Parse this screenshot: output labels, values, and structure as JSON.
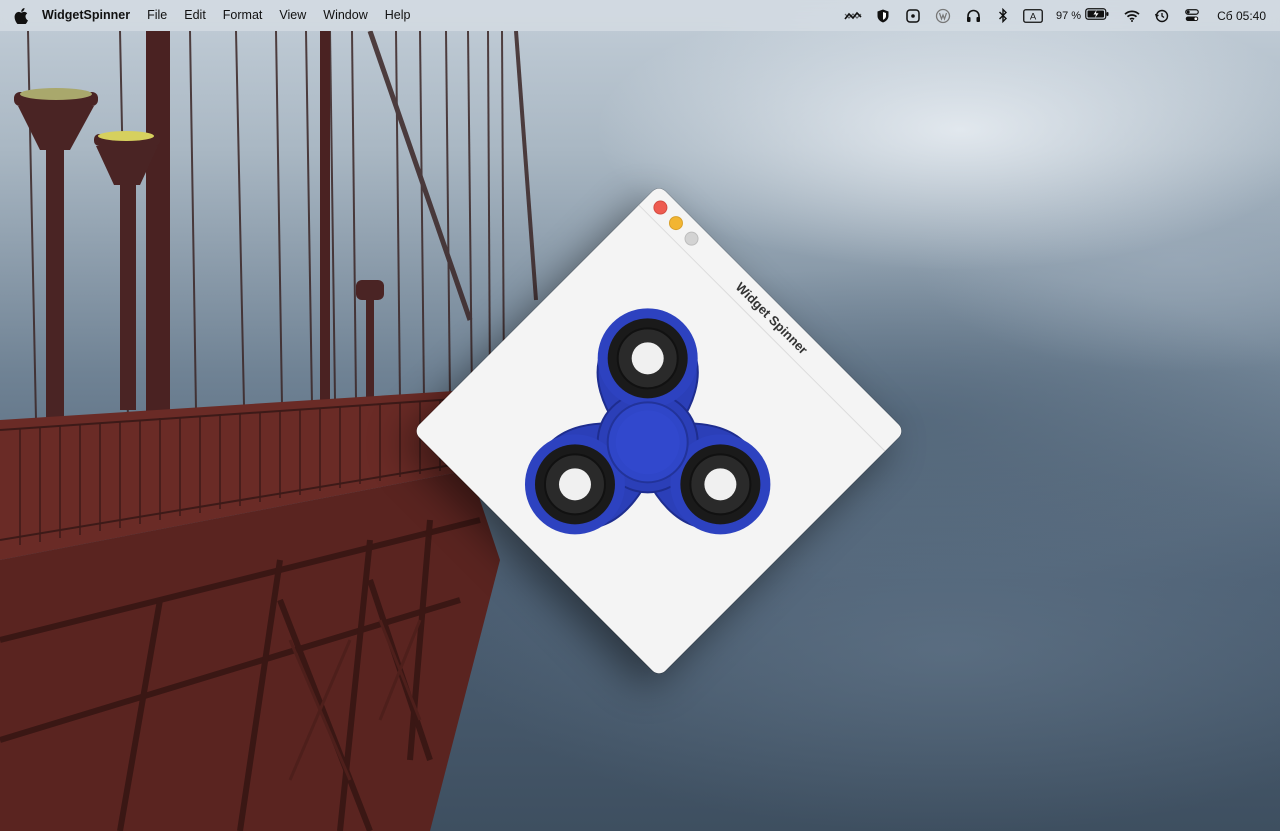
{
  "menubar": {
    "app_name": "WidgetSpinner",
    "menus": [
      "File",
      "Edit",
      "Format",
      "View",
      "Window",
      "Help"
    ],
    "status_icons": [
      "stocks-icon",
      "shield-icon",
      "camera-icon",
      "vpn-icon",
      "headphones-icon",
      "bluetooth-icon",
      "input-source-icon",
      "battery-icon",
      "wifi-icon",
      "time-machine-icon",
      "control-center-icon"
    ],
    "input_source": "A",
    "battery": "97 %",
    "clock": "Сб 05:40"
  },
  "window": {
    "title": "Widget Spinner",
    "rotation_deg": 45,
    "spinner_color": "#2b3fb8"
  }
}
